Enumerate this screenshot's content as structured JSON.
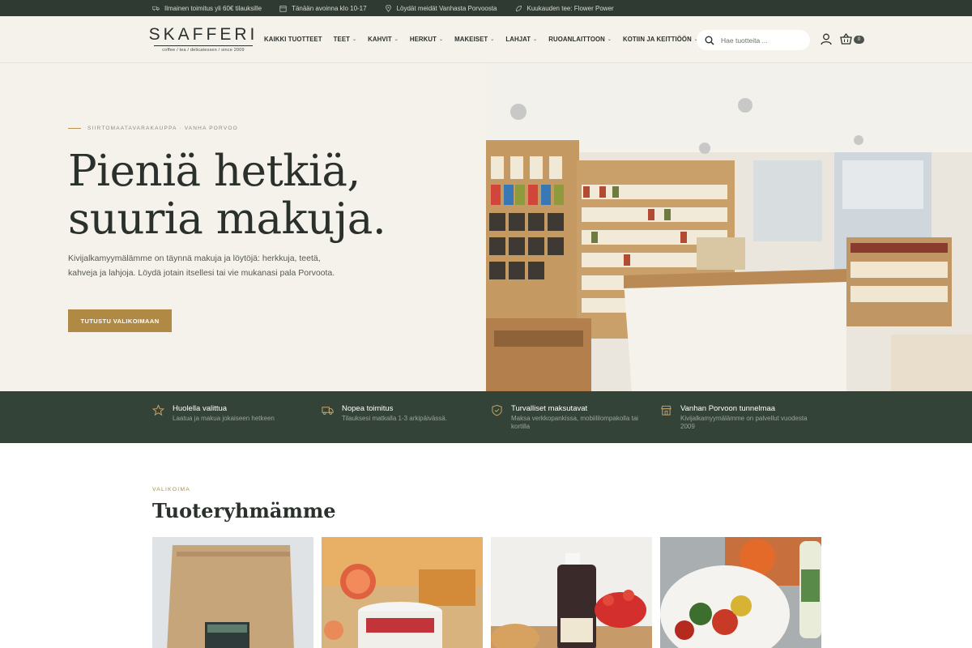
{
  "announcements": [
    {
      "icon": "truck-icon",
      "text": "Ilmainen toimitus yli 60€ tilauksille"
    },
    {
      "icon": "calendar-icon",
      "text": "Tänään avoinna klo 10-17"
    },
    {
      "icon": "map-pin-icon",
      "text": "Löydät meidät Vanhasta Porvoosta"
    },
    {
      "icon": "leaf-icon",
      "text": "Kuukauden tee: Flower Power"
    }
  ],
  "header": {
    "logo_word": "SKAFFERI",
    "logo_sub": "coffee / tea / delicatessen / since 2009",
    "nav": [
      {
        "label": "KAIKKI TUOTTEET",
        "dropdown": false
      },
      {
        "label": "TEET",
        "dropdown": true
      },
      {
        "label": "KAHVIT",
        "dropdown": true
      },
      {
        "label": "HERKUT",
        "dropdown": true
      },
      {
        "label": "MAKEISET",
        "dropdown": true
      },
      {
        "label": "LAHJAT",
        "dropdown": true
      },
      {
        "label": "RUOANLAITTOON",
        "dropdown": true
      },
      {
        "label": "KOTIIN JA KEITTIÖÖN",
        "dropdown": true
      }
    ],
    "search_placeholder": "Hae tuotteita ...",
    "cart_count": "0"
  },
  "hero": {
    "eyebrow": "SIIRTOMAATAVARAKAUPPA · VANHA PORVOO",
    "title_line1": "Pieniä hetkiä,",
    "title_line2": "suuria makuja.",
    "text": "Kivijalkamyymälämme on täynnä makuja ja löytöjä: herkkuja, teetä, kahveja ja lahjoja. Löydä jotain itsellesi tai vie mukanasi pala Porvoota.",
    "button": "TUTUSTU VALIKOIMAAN"
  },
  "features": [
    {
      "icon": "star-icon",
      "title": "Huolella valittua",
      "desc": "Laatua ja makua jokaiseen hetkeen"
    },
    {
      "icon": "delivery-truck-icon",
      "title": "Nopea toimitus",
      "desc": "Tilauksesi matkalla 1-3 arkipäivässä."
    },
    {
      "icon": "shield-check-icon",
      "title": "Turvalliset maksutavat",
      "desc": "Maksa verkkopankissa, mobiililompakolla tai kortilla"
    },
    {
      "icon": "storefront-icon",
      "title": "Vanhan Porvoon tunnelmaa",
      "desc": "Kivijalkamyymälämme on palvellut vuodesta 2009"
    }
  ],
  "categories": {
    "eyebrow": "VALIKOIMA",
    "title": "Tuoteryhmämme"
  },
  "colors": {
    "topbar": "#2f3a33",
    "accent": "#b08a45",
    "feature_band": "#344338",
    "cream": "#f4f2ea"
  }
}
